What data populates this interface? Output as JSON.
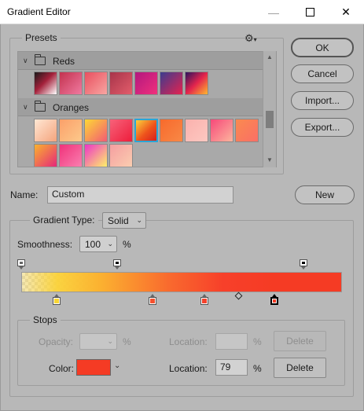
{
  "window": {
    "title": "Gradient Editor",
    "minimize_glyph": "—",
    "close_glyph": "✕"
  },
  "presets": {
    "legend": "Presets",
    "settings_icon": "gear-icon",
    "settings_glyph": "⚙",
    "settings_chevron": "▾",
    "folders": [
      {
        "name": "Reds",
        "swatches": [
          "linear-gradient(135deg,#1a1a1a 0%,#a3203a 45%,#ffffff 100%)",
          "linear-gradient(135deg,#c3324f 0%,#f07aa0 100%)",
          "linear-gradient(135deg,#e94f5f 0%,#f8a6a2 100%)",
          "linear-gradient(135deg,#a7344a 0%,#e35d6b 100%)",
          "linear-gradient(135deg,#b3187f 0%,#f0307c 100%)",
          "linear-gradient(135deg,#3b3c8e 0%,#e6224f 100%)",
          "linear-gradient(135deg,#2b125e 0%,#e3244d 50%,#ffb82e 100%)"
        ]
      },
      {
        "name": "Oranges",
        "swatches": [
          "linear-gradient(135deg,#ffe7d4 0%,#f4a47d 100%)",
          "linear-gradient(135deg,#fba06a 0%,#fdc98b 100%)",
          "linear-gradient(135deg,#fdd835 0%,#f25b74 100%)",
          "linear-gradient(135deg,#f7627a 0%,#ee1d3b 100%)",
          "linear-gradient(135deg,#fbd23b 0%,#ee541c 55%,#d61f1f 100%)",
          "linear-gradient(135deg,#f76a2c 0%,#f98846 100%)",
          "linear-gradient(135deg,#fab1ad 0%,#fdc8c1 100%)",
          "linear-gradient(135deg,#f7497a 0%,#fcb59d 100%)",
          "linear-gradient(135deg,#f98a4f 0%,#fb6f66 100%)",
          "linear-gradient(135deg,#fab22e 0%,#e5287a 100%)",
          "linear-gradient(135deg,#f0327a 0%,#fa7fb0 100%)",
          "linear-gradient(135deg,#ee34c8 0%,#fdf06a 100%)",
          "linear-gradient(135deg,#f59ea0 0%,#fbcdb0 100%)"
        ]
      }
    ],
    "selected_swatch": "Oranges-4"
  },
  "buttons": {
    "ok": "OK",
    "cancel": "Cancel",
    "import": "Import...",
    "export": "Export...",
    "new": "New",
    "delete": "Delete"
  },
  "name": {
    "label": "Name:",
    "value": "Custom"
  },
  "gradient": {
    "legend_label": "Gradient Type:",
    "type": "Solid",
    "smoothness_label": "Smoothness:",
    "smoothness": "100",
    "percent": "%"
  },
  "stops": {
    "legend": "Stops",
    "opacity_label": "Opacity:",
    "opacity_value": "",
    "opacity_location_label": "Location:",
    "opacity_location_value": "",
    "color_label": "Color:",
    "color_value": "#f53b24",
    "color_location_label": "Location:",
    "color_location_value": "79",
    "opacity_stops": [
      {
        "position": 0,
        "color": "#666666"
      },
      {
        "position": 30,
        "color": "#000000"
      },
      {
        "position": 88,
        "color": "#000000"
      }
    ],
    "color_stops": [
      {
        "position": 11,
        "color": "#f8d533"
      },
      {
        "position": 41,
        "color": "#f5512e"
      },
      {
        "position": 57,
        "color": "#f5422c"
      },
      {
        "position": 79,
        "color": "#f53b24",
        "active": true
      }
    ],
    "midpoint": 68
  },
  "chevron": "⌄"
}
